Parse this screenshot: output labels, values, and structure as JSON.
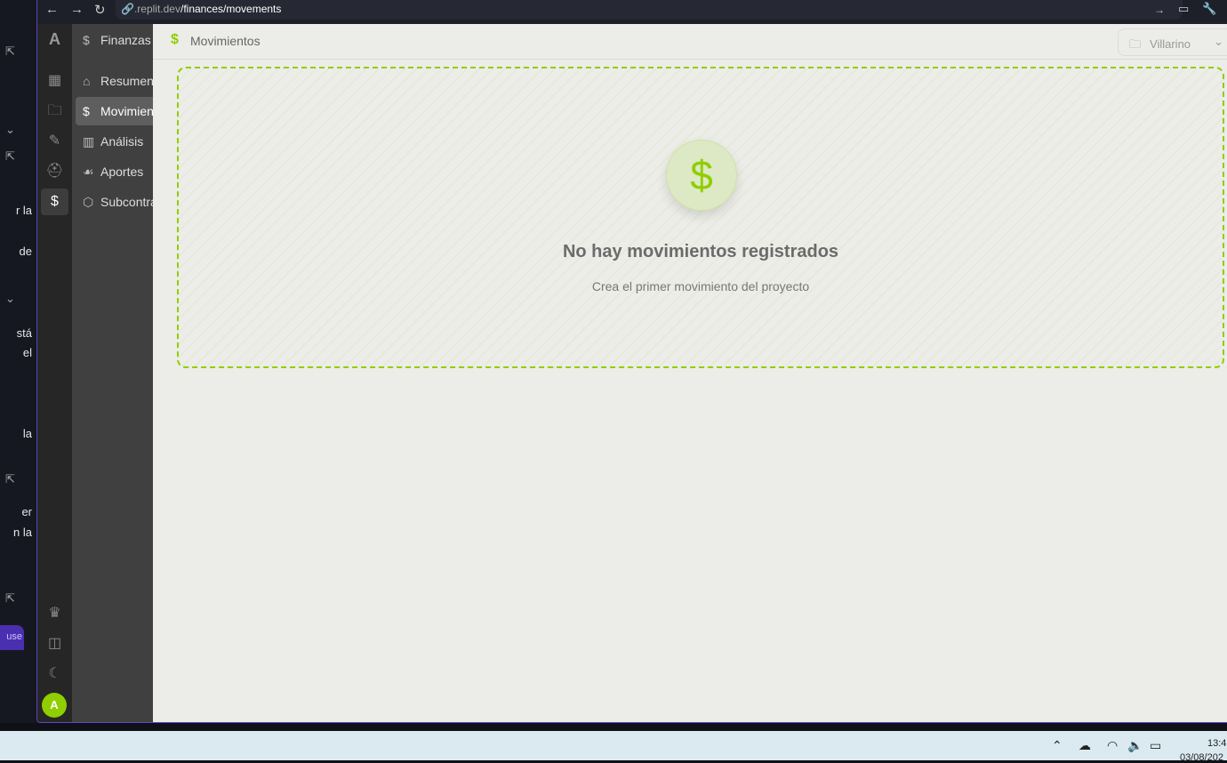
{
  "left_panel": {
    "fragments": [
      "r la",
      "de",
      "stá",
      "el",
      "la",
      "er",
      "n la"
    ],
    "use_button": "use"
  },
  "browser": {
    "url_host": ".replit.dev",
    "url_path": "/finances/movements"
  },
  "rail": {
    "logo": "A",
    "avatar": "A"
  },
  "sidebar": {
    "section": "Finanzas",
    "items": [
      {
        "label": "Resumen"
      },
      {
        "label": "Movimientos"
      },
      {
        "label": "Análisis"
      },
      {
        "label": "Aportes"
      },
      {
        "label": "Subcontratos"
      }
    ]
  },
  "header": {
    "title": "Movimientos",
    "project": "Villarino"
  },
  "empty": {
    "title": "No hay movimientos registrados",
    "subtitle": "Crea el primer movimiento del proyecto"
  },
  "taskbar": {
    "time": "13:4",
    "date": "03/08/202"
  },
  "colors": {
    "accent": "#8fce00"
  }
}
